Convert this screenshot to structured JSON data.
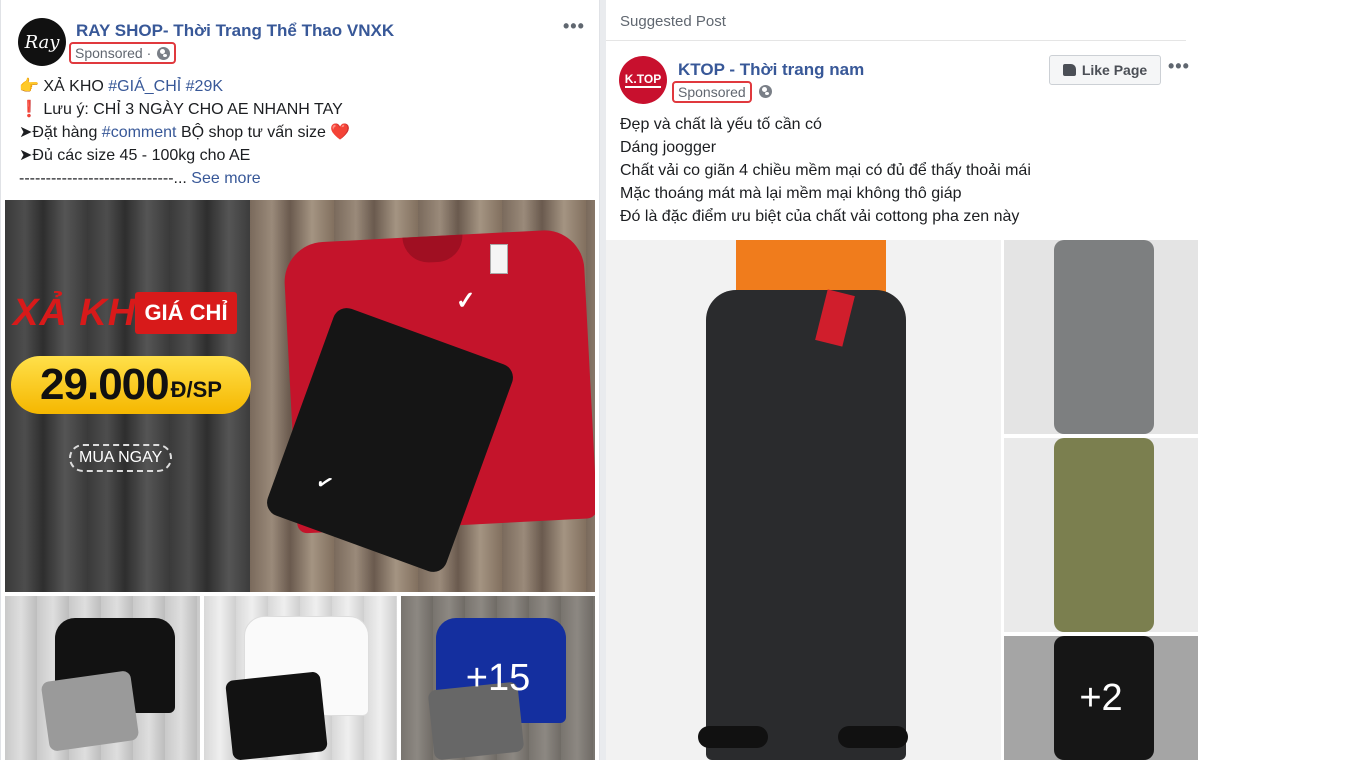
{
  "post1": {
    "page_name": "RAY SHOP- Thời Trang Thể Thao VNXK",
    "avatar_text": "Ray",
    "sponsored": "Sponsored ·",
    "more": "•••",
    "lines": [
      {
        "prefix": "👉 XẢ KHO ",
        "tags": "#GIÁ_CHỈ #29K"
      },
      {
        "prefix": "❗ Lưu ý: CHỈ 3 NGÀY CHO AE NHANH TAY"
      },
      {
        "prefix": "➤Đặt hàng ",
        "tag": "#comment",
        "suffix": " BỘ shop tư vấn size ❤️"
      },
      {
        "prefix": "➤Đủ các size 45 - 100kg cho AE"
      },
      {
        "prefix": "-----------------------------...",
        "see_more": " See more"
      }
    ],
    "image": {
      "promo_left": "XẢ KHO",
      "promo_right": "GIÁ CHỈ",
      "price": "29.000",
      "price_unit": "Đ/SP",
      "cta": "MUA NGAY"
    },
    "more_photos": "+15"
  },
  "post2": {
    "suggested": "Suggested Post",
    "page_name": "KTOP - Thời trang nam",
    "avatar_text": "K.TOP",
    "sponsored": "Sponsored",
    "like_page": "Like Page",
    "more": "•••",
    "lines": [
      "Đẹp và chất là yếu tố cần có",
      "Dáng joogger",
      "Chất vải co giãn 4 chiều mềm mại có đủ để thấy thoải mái",
      "Mặc thoáng mát mà lại mềm mại không thô giáp",
      "Đó là đặc điểm ưu biệt của chất vải cottong pha zen này"
    ],
    "more_photos": "+2"
  },
  "colors": {
    "link": "#385898",
    "sponsored_highlight": "#e0393e",
    "promo_red": "#d81a1a",
    "price_yellow": "#f5b700"
  }
}
